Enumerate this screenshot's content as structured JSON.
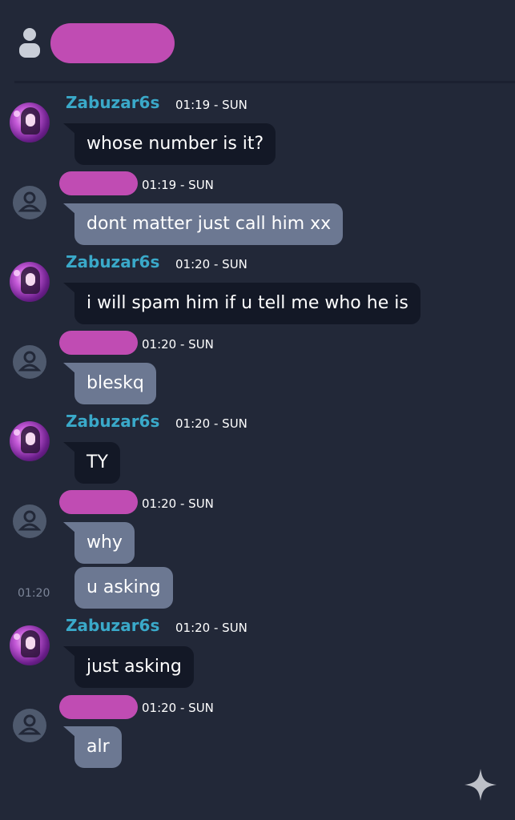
{
  "header": {
    "icon": "user-icon",
    "name_redacted": true
  },
  "messages": [
    {
      "sender": "Zabuzar6s",
      "time": "01:19 - SUN",
      "text": "whose number is it?"
    },
    {
      "sender": "",
      "time": "01:19 - SUN",
      "text": "dont matter just call him xx"
    },
    {
      "sender": "Zabuzar6s",
      "time": "01:20 - SUN",
      "text": "i will spam him if u tell me who he is"
    },
    {
      "sender": "",
      "time": "01:20 - SUN",
      "text": "bleskq"
    },
    {
      "sender": "Zabuzar6s",
      "time": "01:20 - SUN",
      "text": "TY"
    },
    {
      "sender": "",
      "time": "01:20 - SUN",
      "text": "why"
    },
    {
      "followup_time": "01:20",
      "text": "u asking"
    },
    {
      "sender": "Zabuzar6s",
      "time": "01:20 - SUN",
      "text": "just asking"
    },
    {
      "sender": "",
      "time": "01:20 - SUN",
      "text": "alr"
    }
  ],
  "colors": {
    "background": "#222838",
    "username": "#3aa9c9",
    "redaction": "#c04cb3",
    "own_bubble": "#131826",
    "other_bubble": "#6c7892"
  },
  "icons": {
    "corner": "sparkle-icon"
  }
}
